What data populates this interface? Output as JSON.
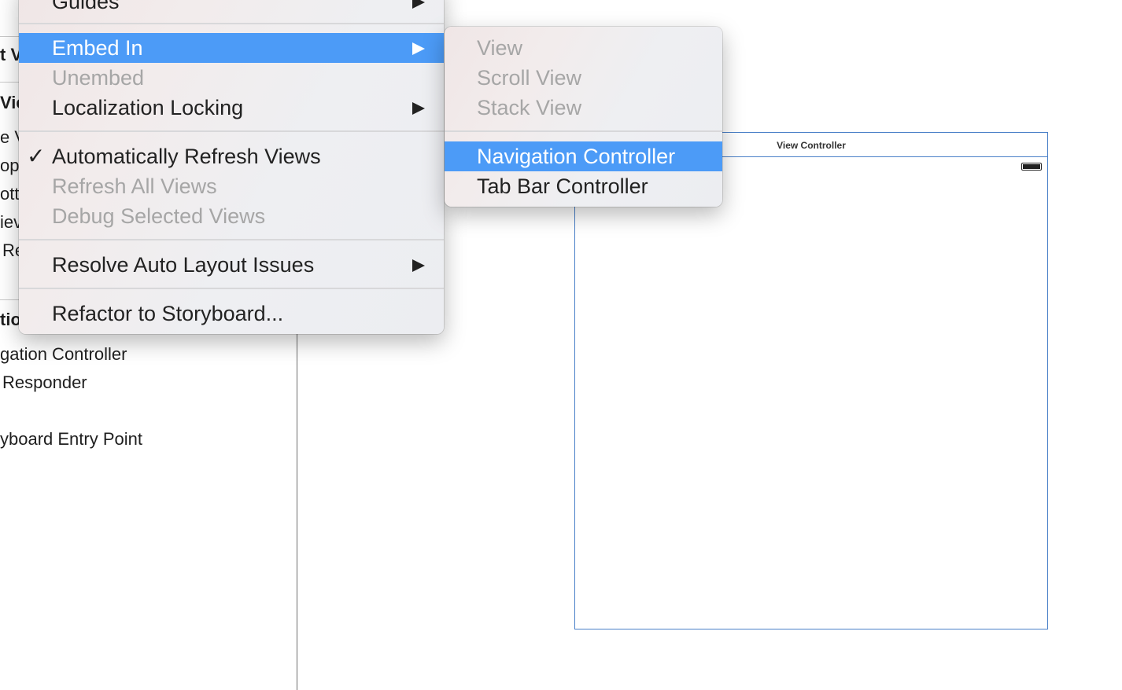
{
  "outline": {
    "rows": [
      "t V",
      "Vie",
      "e V",
      "op",
      "ott",
      "iev",
      "Re",
      "tio",
      "gation Controller",
      "Responder",
      "yboard Entry Point"
    ]
  },
  "canvas": {
    "scene_title": "View Controller"
  },
  "editor_menu": {
    "items": [
      {
        "label": "Guides",
        "disabled": false,
        "submenu": true
      },
      {
        "label": "Embed In",
        "highlighted": true,
        "submenu": true
      },
      {
        "label": "Unembed",
        "disabled": true
      },
      {
        "label": "Localization Locking",
        "submenu": true
      },
      {
        "label": "Automatically Refresh Views",
        "checked": true,
        "check_glyph": "✓"
      },
      {
        "label": "Refresh All Views",
        "disabled": true
      },
      {
        "label": "Debug Selected Views",
        "disabled": true
      },
      {
        "label": "Resolve Auto Layout Issues",
        "submenu": true
      },
      {
        "label": "Refactor to Storyboard..."
      }
    ]
  },
  "embed_submenu": {
    "items": [
      {
        "label": "View",
        "disabled": true
      },
      {
        "label": "Scroll View",
        "disabled": true
      },
      {
        "label": "Stack View",
        "disabled": true
      },
      {
        "label": "Navigation Controller",
        "highlighted": true
      },
      {
        "label": "Tab Bar Controller"
      }
    ]
  },
  "colors": {
    "highlight": "#4c9bf7",
    "disabled_text": "#a6a6a6",
    "scene_border": "#4a80c8"
  }
}
